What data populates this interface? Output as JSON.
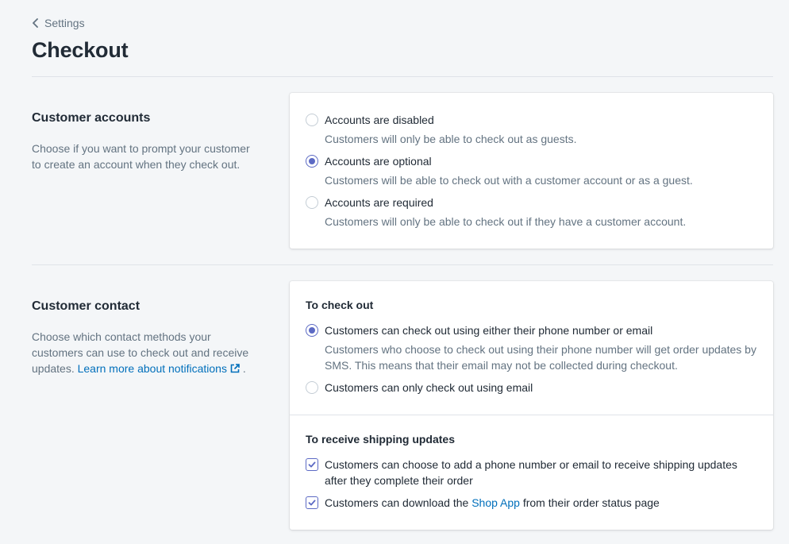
{
  "breadcrumb": {
    "label": "Settings"
  },
  "page": {
    "title": "Checkout"
  },
  "colors": {
    "accent": "#5c6ac4",
    "link": "#006fbb",
    "background": "#f4f6f8"
  },
  "customer_accounts": {
    "heading": "Customer accounts",
    "description": "Choose if you want to prompt your customer to create an account when they check out.",
    "options": [
      {
        "label": "Accounts are disabled",
        "help": "Customers will only be able to check out as guests.",
        "selected": false
      },
      {
        "label": "Accounts are optional",
        "help": "Customers will be able to check out with a customer account or as a guest.",
        "selected": true
      },
      {
        "label": "Accounts are required",
        "help": "Customers will only be able to check out if they have a customer account.",
        "selected": false
      }
    ]
  },
  "customer_contact": {
    "heading": "Customer contact",
    "description": "Choose which contact methods your customers can use to check out and receive updates.",
    "learn_more_link": "Learn more about notifications",
    "period": ".",
    "checkout": {
      "heading": "To check out",
      "options": [
        {
          "label": "Customers can check out using either their phone number or email",
          "help": "Customers who choose to check out using their phone number will get order updates by SMS. This means that their email may not be collected during checkout.",
          "selected": true
        },
        {
          "label": "Customers can only check out using email",
          "selected": false
        }
      ]
    },
    "shipping": {
      "heading": "To receive shipping updates",
      "options": [
        {
          "label": "Customers can choose to add a phone number or email to receive shipping updates after they complete their order",
          "checked": true
        },
        {
          "label_before": "Customers can download the",
          "link": "Shop App",
          "label_after": "from their order status page",
          "checked": true
        }
      ]
    }
  }
}
